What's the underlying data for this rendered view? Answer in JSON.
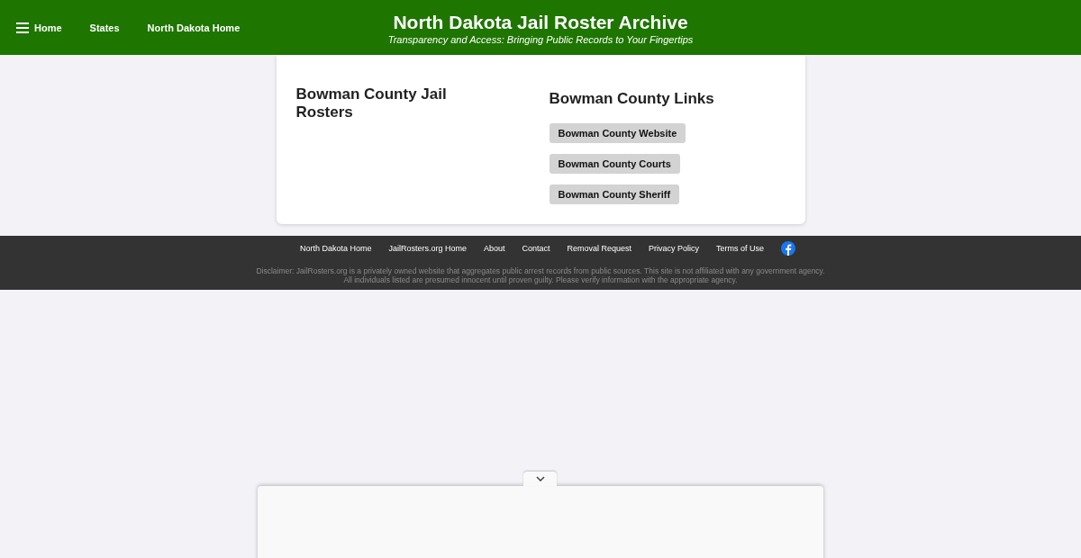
{
  "header": {
    "nav": [
      {
        "label": "Home",
        "kind": "menu"
      },
      {
        "label": "States",
        "kind": "link"
      },
      {
        "label": "North Dakota Home",
        "kind": "link"
      }
    ],
    "title": "North Dakota Jail Roster Archive",
    "subtitle": "Transparency and Access: Bringing Public Records to Your Fingertips"
  },
  "main": {
    "rosters_heading": "Bowman County Jail Rosters",
    "links_heading": "Bowman County Links",
    "links": [
      "Bowman County Website",
      "Bowman County Courts",
      "Bowman County Sheriff"
    ]
  },
  "footer": {
    "links": [
      "North Dakota Home",
      "JailRosters.org Home",
      "About",
      "Contact",
      "Removal Request",
      "Privacy Policy",
      "Terms of Use"
    ],
    "disclaimer": "Disclaimer: JailRosters.org is a privately owned website that aggregates public arrest records from public sources. This site is not affiliated with any government agency. All individuals listed are presumed innocent until proven guilty. Please verify information with the appropriate agency."
  }
}
